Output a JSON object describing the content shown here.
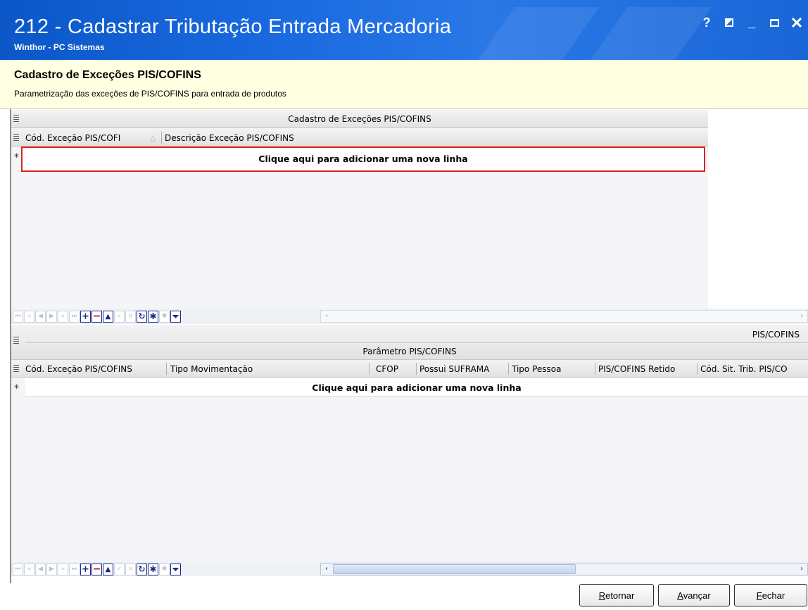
{
  "window": {
    "title": "212 - Cadastrar Tributação Entrada Mercadoria",
    "subtitle": "Winthor - PC Sistemas",
    "controls": {
      "help": "?",
      "minimize": "_"
    }
  },
  "header": {
    "title": "Cadastro de Exceções PIS/COFINS",
    "description": "Parametrização das exceções de PIS/COFINS para entrada de produtos"
  },
  "grid_excecoes": {
    "band_title": "Cadastro de Exceções PIS/COFINS",
    "columns": [
      "Cód. Exceção PIS/COFI",
      "Descrição Exceção PIS/COFINS"
    ],
    "sort_indicator": "△",
    "new_row_text": "Clique aqui para adicionar uma nova linha",
    "new_row_marker": "*"
  },
  "grid_parametros": {
    "band_right": "PIS/COFINS",
    "band_title": "Parâmetro PIS/COFINS",
    "columns": [
      "Cód. Exceção PIS/COFINS",
      "Tipo Movimentação",
      "CFOP",
      "Possui SUFRAMA",
      "Tipo Pessoa",
      "PIS/COFINS Retido",
      "Cód. Sit. Trib. PIS/CO"
    ],
    "new_row_text": "Clique aqui para adicionar uma nova linha",
    "new_row_marker": "*"
  },
  "navigator": {
    "first": "⏮",
    "prev_page": "«",
    "prev": "◀",
    "next": "▶",
    "next_page": "»",
    "last": "⏭",
    "insert": "+",
    "delete": "−",
    "edit": "▲",
    "post": "✓",
    "cancel": "×",
    "refresh": "↻",
    "bookmark": "✱",
    "goto_bookmark": "✱",
    "filter": "⏷",
    "scroll_left": "‹",
    "scroll_right": "›"
  },
  "buttons": {
    "back": "Retornar",
    "next": "Avançar",
    "close": "Fechar"
  },
  "colors": {
    "titlebar": "#1a6ae0",
    "header_bg": "#ffffe1",
    "highlight": "#e02020"
  }
}
